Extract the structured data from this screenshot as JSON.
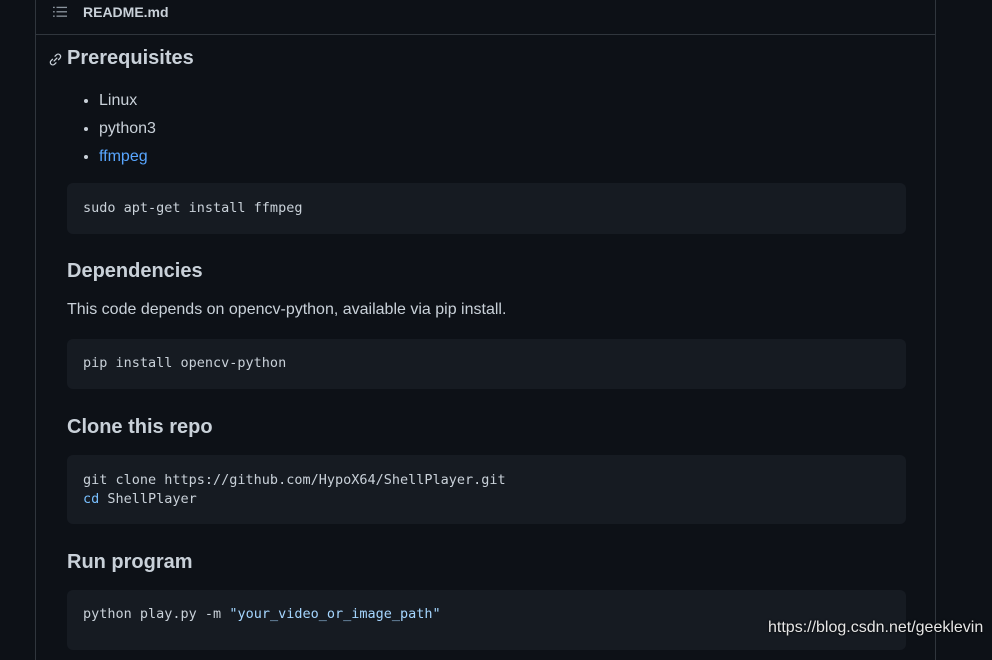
{
  "header": {
    "filename": "README.md"
  },
  "sections": {
    "prerequisites": {
      "title": "Prerequisites",
      "items": [
        "Linux",
        "python3"
      ],
      "link_item": "ffmpeg",
      "code": "sudo apt-get install ffmpeg"
    },
    "dependencies": {
      "title": "Dependencies",
      "text": "This code depends on opencv-python, available via pip install.",
      "code": "pip install opencv-python"
    },
    "clone": {
      "title": "Clone this repo",
      "code_line1": "git clone https://github.com/HypoX64/ShellPlayer.git",
      "code_line2_kw": "cd",
      "code_line2_rest": " ShellPlayer"
    },
    "run": {
      "title": "Run program",
      "code_cmd": "python play.py -m ",
      "code_arg": "\"your_video_or_image_path\""
    }
  },
  "watermark": "https://blog.csdn.net/geeklevin",
  "colors": {
    "background": "#0d1117",
    "code_bg": "#161b22",
    "link": "#58a6ff",
    "text": "#c9d1d9"
  }
}
